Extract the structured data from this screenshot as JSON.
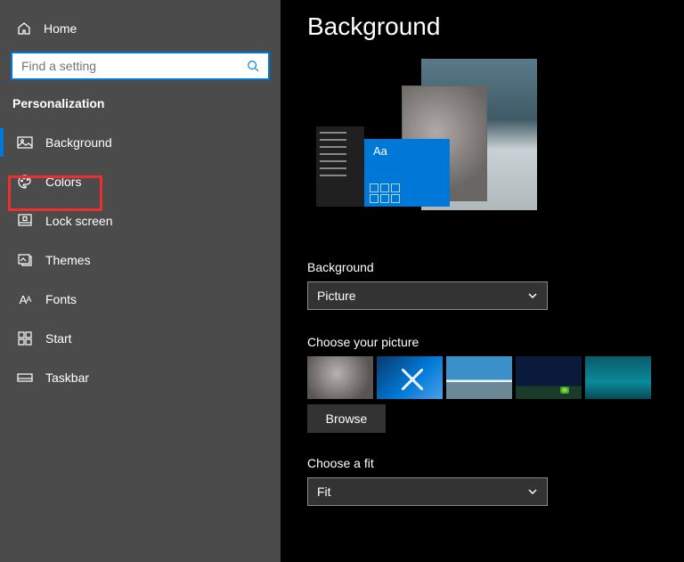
{
  "sidebar": {
    "home": "Home",
    "search_placeholder": "Find a setting",
    "section": "Personalization",
    "items": [
      {
        "icon": "picture-icon",
        "label": "Background"
      },
      {
        "icon": "palette-icon",
        "label": "Colors"
      },
      {
        "icon": "lock-screen-icon",
        "label": "Lock screen"
      },
      {
        "icon": "themes-icon",
        "label": "Themes"
      },
      {
        "icon": "fonts-icon",
        "label": "Fonts"
      },
      {
        "icon": "start-icon",
        "label": "Start"
      },
      {
        "icon": "taskbar-icon",
        "label": "Taskbar"
      }
    ]
  },
  "main": {
    "title": "Background",
    "preview_aa": "Aa",
    "bg_label": "Background",
    "bg_value": "Picture",
    "choose_pic_label": "Choose your picture",
    "browse": "Browse",
    "fit_label": "Choose a fit",
    "fit_value": "Fit"
  }
}
